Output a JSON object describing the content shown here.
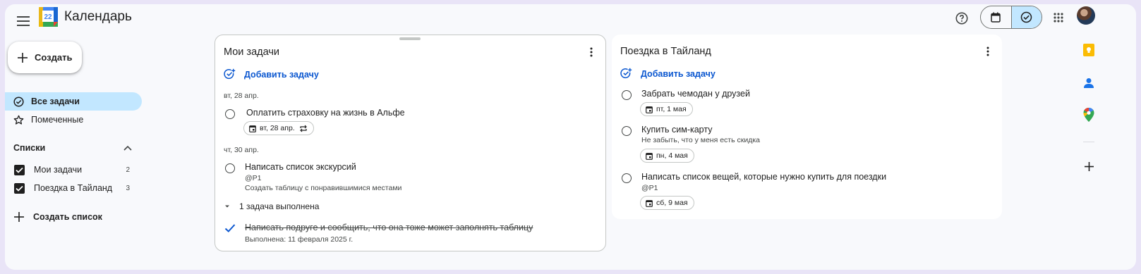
{
  "header": {
    "app_title": "Календарь",
    "logo_number": "22",
    "icons": [
      "menu-icon",
      "help-icon",
      "calendar-icon",
      "tasks-icon",
      "apps-grid-icon"
    ],
    "toggle_active": "tasks"
  },
  "sidebar": {
    "create_label": "Создать",
    "nav": [
      {
        "label": "Все задачи",
        "active": true
      },
      {
        "label": "Помеченные",
        "active": false
      }
    ],
    "lists_heading": "Списки",
    "lists": [
      {
        "label": "Мои задачи",
        "count": "2",
        "checked": true
      },
      {
        "label": "Поездка в Тайланд",
        "count": "3",
        "checked": true
      }
    ],
    "create_list_label": "Создать список"
  },
  "panels": [
    {
      "title": "Мои задачи",
      "add_task": "Добавить задачу",
      "groups": [
        {
          "date": "вт, 28 апр.",
          "tasks": [
            {
              "title": "Оплатить страховку на жизнь в Альфе",
              "chip": "вт, 28 апр.",
              "repeat": true
            }
          ]
        },
        {
          "date": "чт, 30 апр.",
          "tasks": [
            {
              "title": "Написать список экскурсий",
              "sub1": "@P1",
              "sub2": "Создать таблицу с понравившимися местами"
            }
          ]
        }
      ],
      "completed_label": "1 задача выполнена",
      "completed": [
        {
          "title": "Написать подруге и сообщить, что она тоже может заполнять таблицу",
          "done": "Выполнена: 11 февраля 2025 г."
        }
      ]
    },
    {
      "title": "Поездка в Тайланд",
      "add_task": "Добавить задачу",
      "tasks": [
        {
          "title": "Забрать чемодан у друзей",
          "chip": "пт, 1 мая"
        },
        {
          "title": "Купить сим-карту",
          "sub1": "Не забыть, что у меня есть скидка",
          "chip": "пн, 4 мая"
        },
        {
          "title": "Написать список вещей, которые нужно купить для поездки",
          "sub1": "@P1",
          "chip": "сб, 9 мая"
        }
      ]
    }
  ],
  "right_rail": [
    "keep-icon",
    "contacts-icon",
    "maps-icon",
    "add-icon"
  ],
  "colors": {
    "accent_blue": "#0b57d0",
    "active_bg": "#c2e7ff",
    "page_bg": "#e9e4f7"
  }
}
